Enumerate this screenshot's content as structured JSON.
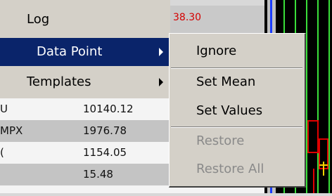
{
  "menu": {
    "items": [
      {
        "label": "Log",
        "has_submenu": false,
        "selected": false
      },
      {
        "label": "Data Point",
        "has_submenu": true,
        "selected": true
      },
      {
        "label": "Templates",
        "has_submenu": true,
        "selected": false
      }
    ]
  },
  "submenu": {
    "items": [
      {
        "label": "Ignore",
        "enabled": true
      },
      {
        "label": "Set Mean",
        "enabled": true
      },
      {
        "label": "Set Values",
        "enabled": true
      },
      {
        "label": "Restore",
        "enabled": false
      },
      {
        "label": "Restore All",
        "enabled": false
      }
    ]
  },
  "background": {
    "price_value": "38.30",
    "rows": [
      {
        "symbol": "U",
        "value": "10140.12"
      },
      {
        "symbol": "MPX",
        "value": "1976.78"
      },
      {
        "symbol": "(",
        "value": "1154.05"
      },
      {
        "symbol": "",
        "value": "15.48"
      }
    ]
  },
  "colors": {
    "menu_bg": "#d4d0c8",
    "highlight": "#0a246a",
    "disabled_text": "#8a8a8a",
    "price_text": "#d40000",
    "chart_bg": "#000000"
  }
}
